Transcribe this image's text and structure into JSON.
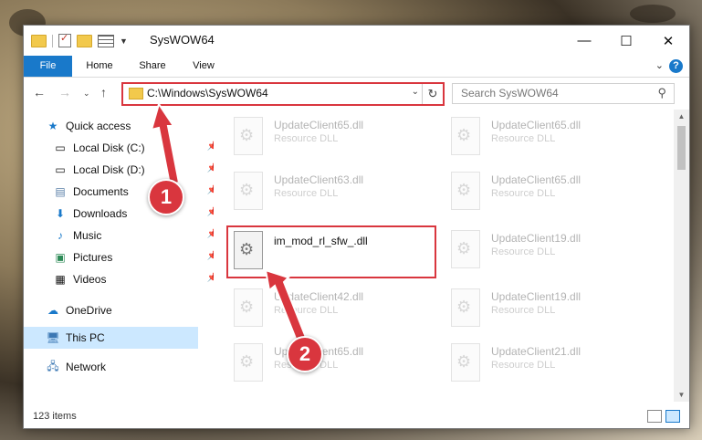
{
  "window": {
    "title": "SysWOW64"
  },
  "ribbon": {
    "tabs": [
      "File",
      "Home",
      "Share",
      "View"
    ]
  },
  "address": {
    "path": "C:\\Windows\\SysWOW64"
  },
  "search": {
    "placeholder": "Search SysWOW64"
  },
  "nav": {
    "items": [
      {
        "label": "Quick access",
        "icon": "star-icon"
      },
      {
        "label": "Local Disk (C:)",
        "icon": "drive-icon",
        "pinned": true
      },
      {
        "label": "Local Disk (D:)",
        "icon": "drive-icon",
        "pinned": true
      },
      {
        "label": "Documents",
        "icon": "documents-icon",
        "pinned": true
      },
      {
        "label": "Downloads",
        "icon": "download-icon",
        "pinned": true
      },
      {
        "label": "Music",
        "icon": "music-icon",
        "pinned": true
      },
      {
        "label": "Pictures",
        "icon": "pictures-icon",
        "pinned": true
      },
      {
        "label": "Videos",
        "icon": "videos-icon",
        "pinned": true
      },
      {
        "label": "OneDrive",
        "icon": "cloud-icon"
      },
      {
        "label": "This PC",
        "icon": "computer-icon",
        "selected": true
      },
      {
        "label": "Network",
        "icon": "network-icon"
      }
    ]
  },
  "files": {
    "left": [
      {
        "name": "UpdateClient65.dll",
        "desc": "Resource DLL"
      },
      {
        "name": "UpdateClient63.dll",
        "desc": "Resource DLL"
      },
      {
        "name": "im_mod_rl_sfw_.dll",
        "desc": ""
      },
      {
        "name": "UpdateClient42.dll",
        "desc": "Resource DLL"
      },
      {
        "name": "UpdateClient65.dll",
        "desc": "Resource DLL"
      }
    ],
    "right": [
      {
        "name": "UpdateClient65.dll",
        "desc": "Resource DLL"
      },
      {
        "name": "UpdateClient65.dll",
        "desc": "Resource DLL"
      },
      {
        "name": "UpdateClient19.dll",
        "desc": "Resource DLL"
      },
      {
        "name": "UpdateClient19.dll",
        "desc": "Resource DLL"
      },
      {
        "name": "UpdateClient21.dll",
        "desc": "Resource DLL"
      }
    ]
  },
  "status": {
    "count": "123 items"
  },
  "annotations": {
    "one": "1",
    "two": "2"
  }
}
